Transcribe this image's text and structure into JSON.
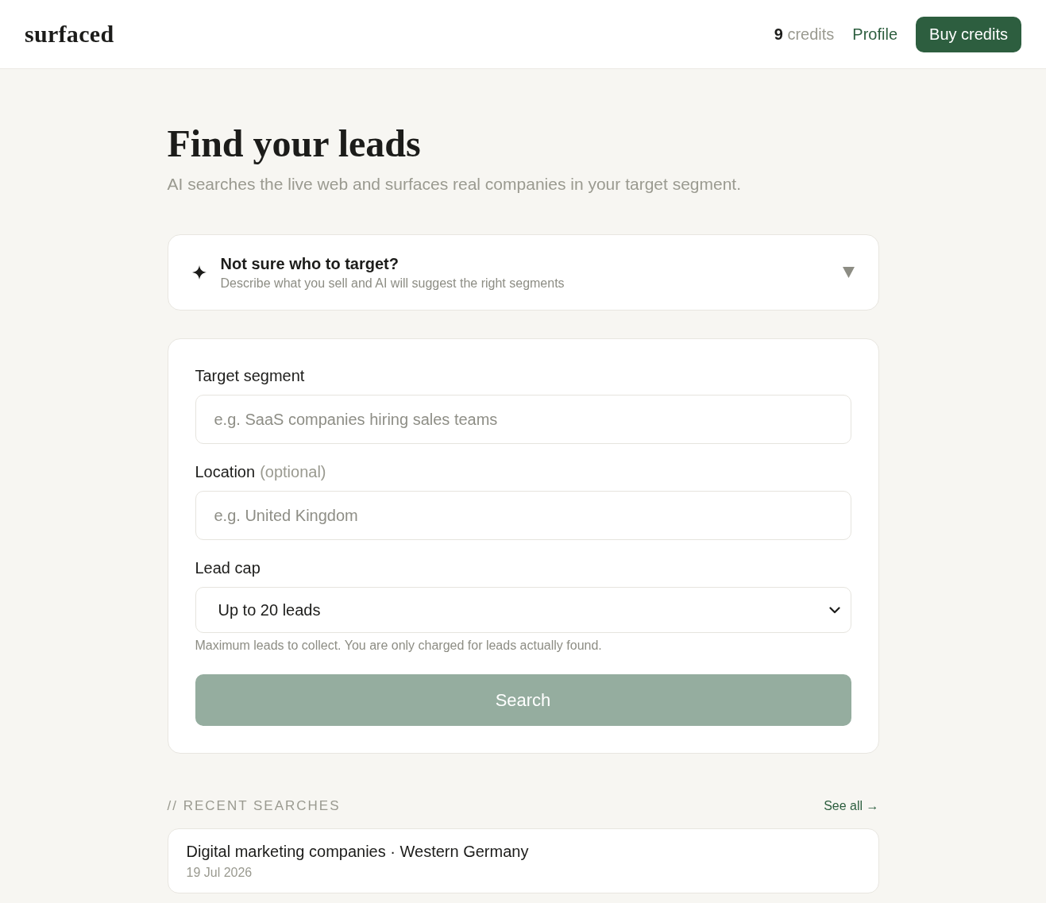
{
  "header": {
    "logo": "surfaced",
    "credits": "**9** credits",
    "profile_link": "Profile",
    "buy_button": "Buy credits"
  },
  "page": {
    "title": "Find your leads",
    "subtitle": "AI searches the live web and surfaces real companies in your target segment."
  },
  "suggest_panel": {
    "title": "Not sure who to target?",
    "description": "Describe what you sell and AI will suggest the right segments",
    "expanded": false
  },
  "form": {
    "fields": [
      {
        "kind": "text",
        "label": "Target segment",
        "placeholder": "e.g. SaaS companies hiring sales teams"
      },
      {
        "kind": "text",
        "label": "Location",
        "note": "(optional)",
        "placeholder": "e.g. United Kingdom"
      },
      {
        "kind": "select",
        "label": "Lead cap",
        "value": "Up to 20 leads",
        "hint": "Maximum leads to collect. You are only charged for leads actually found."
      }
    ],
    "search_button": {
      "label": "Search",
      "disabled": true
    }
  },
  "recent_searches": {
    "heading": "// RECENT SEARCHES",
    "see_all": "See all →",
    "items": [
      {
        "title": "Digital marketing companies · Western Germany",
        "date": "19 Jul 2026"
      }
    ]
  }
}
